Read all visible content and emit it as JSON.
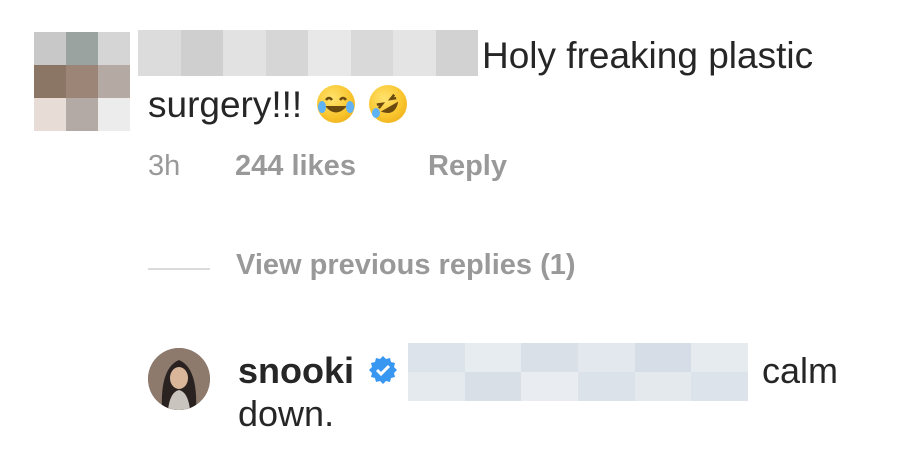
{
  "comment": {
    "text_line1": "Holy freaking plastic",
    "text_line2": "surgery!!!",
    "emojis": [
      "tears-of-joy-emoji",
      "rolling-on-floor-laughing-emoji"
    ],
    "time": "3h",
    "likes": "244 likes",
    "reply_label": "Reply"
  },
  "thread": {
    "view_previous_label": "View previous replies (1)"
  },
  "reply": {
    "username": "snooki",
    "verified": true,
    "text_end": "calm",
    "text_line2": "down."
  },
  "colors": {
    "text": "#262626",
    "meta": "#999999",
    "verified_badge": "#3897f0",
    "background": "#ffffff"
  }
}
